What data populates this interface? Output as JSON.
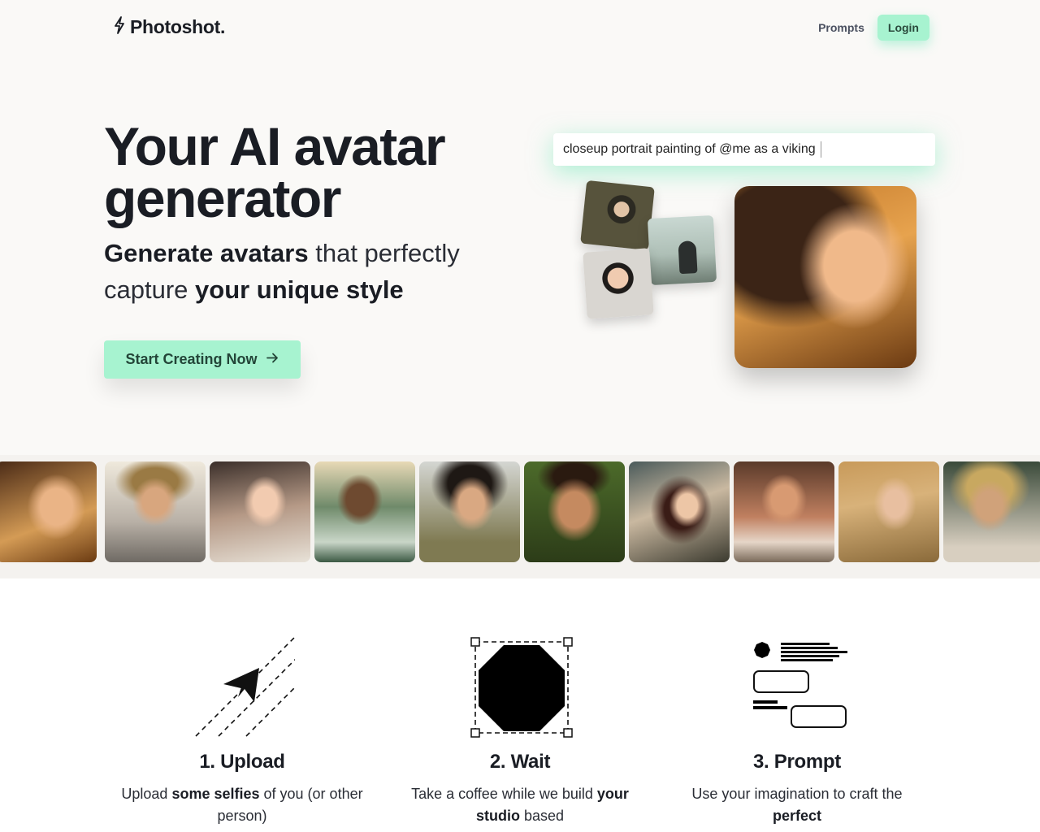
{
  "header": {
    "logo_text": "Photoshot.",
    "nav_prompts": "Prompts",
    "login_label": "Login"
  },
  "hero": {
    "title": "Your AI avatar generator",
    "subtitle_bold1": "Generate avatars",
    "subtitle_text1": " that perfectly capture ",
    "subtitle_bold2": "your unique style",
    "cta_label": "Start Creating Now"
  },
  "prompt_demo": {
    "input_value": "closeup portrait painting of @me as a viking"
  },
  "steps": [
    {
      "title": "1. Upload",
      "desc_pre": "Upload ",
      "desc_bold": "some selfies",
      "desc_post": " of you (or other person)"
    },
    {
      "title": "2. Wait",
      "desc_pre": "Take a coffee while we build ",
      "desc_bold": "your studio",
      "desc_post": " based"
    },
    {
      "title": "3. Prompt",
      "desc_pre": "Use your imagination to craft the ",
      "desc_bold": "perfect",
      "desc_post": ""
    }
  ],
  "icons": {
    "logo": "bolt-icon",
    "cta": "arrow-right-icon",
    "step1": "paper-plane-icon",
    "step2": "octagon-selection-icon",
    "step3": "prompt-layout-icon"
  },
  "colors": {
    "accent": "#a7f3d0",
    "text": "#1a1d24",
    "background": "#faf9f7"
  }
}
